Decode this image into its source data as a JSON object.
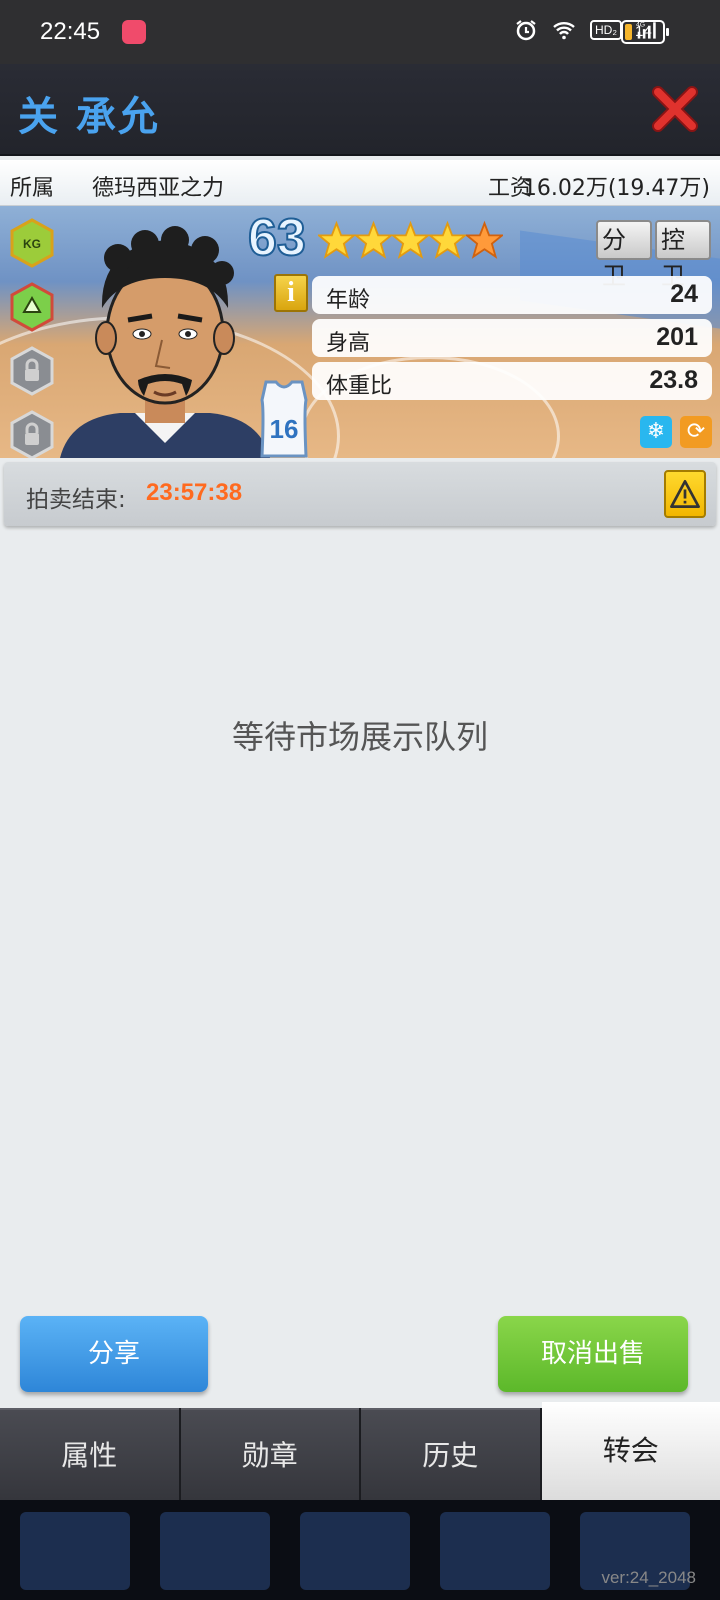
{
  "status_bar": {
    "time": "22:45",
    "network": "4G",
    "hd": "HD₂",
    "battery": "14"
  },
  "header": {
    "player_name": "关 承允"
  },
  "info": {
    "team_label": "所属",
    "team": "德玛西亚之力",
    "salary_label": "工资",
    "salary": "16.02万(19.47万)"
  },
  "player": {
    "rating": "63",
    "stars": 5,
    "positions": [
      "分卫",
      "控卫"
    ],
    "jersey_number": "16",
    "info_icon": "i",
    "stats": [
      {
        "label": "年龄",
        "value": "24"
      },
      {
        "label": "身高",
        "value": "201"
      },
      {
        "label": "体重比",
        "value": "23.8"
      }
    ]
  },
  "auction": {
    "label": "拍卖结束:",
    "countdown": "23:57:38"
  },
  "message": "等待市场展示队列",
  "buttons": {
    "share": "分享",
    "cancel_sale": "取消出售"
  },
  "tabs": [
    {
      "label": "属性",
      "active": false
    },
    {
      "label": "勋章",
      "active": false
    },
    {
      "label": "历史",
      "active": false
    },
    {
      "label": "转会",
      "active": true
    }
  ],
  "version": "ver:24_2048",
  "colors": {
    "name": "#4aa3ef",
    "countdown": "#ff6a1f",
    "share": "#3b97e6",
    "cancel": "#6ec23a"
  }
}
